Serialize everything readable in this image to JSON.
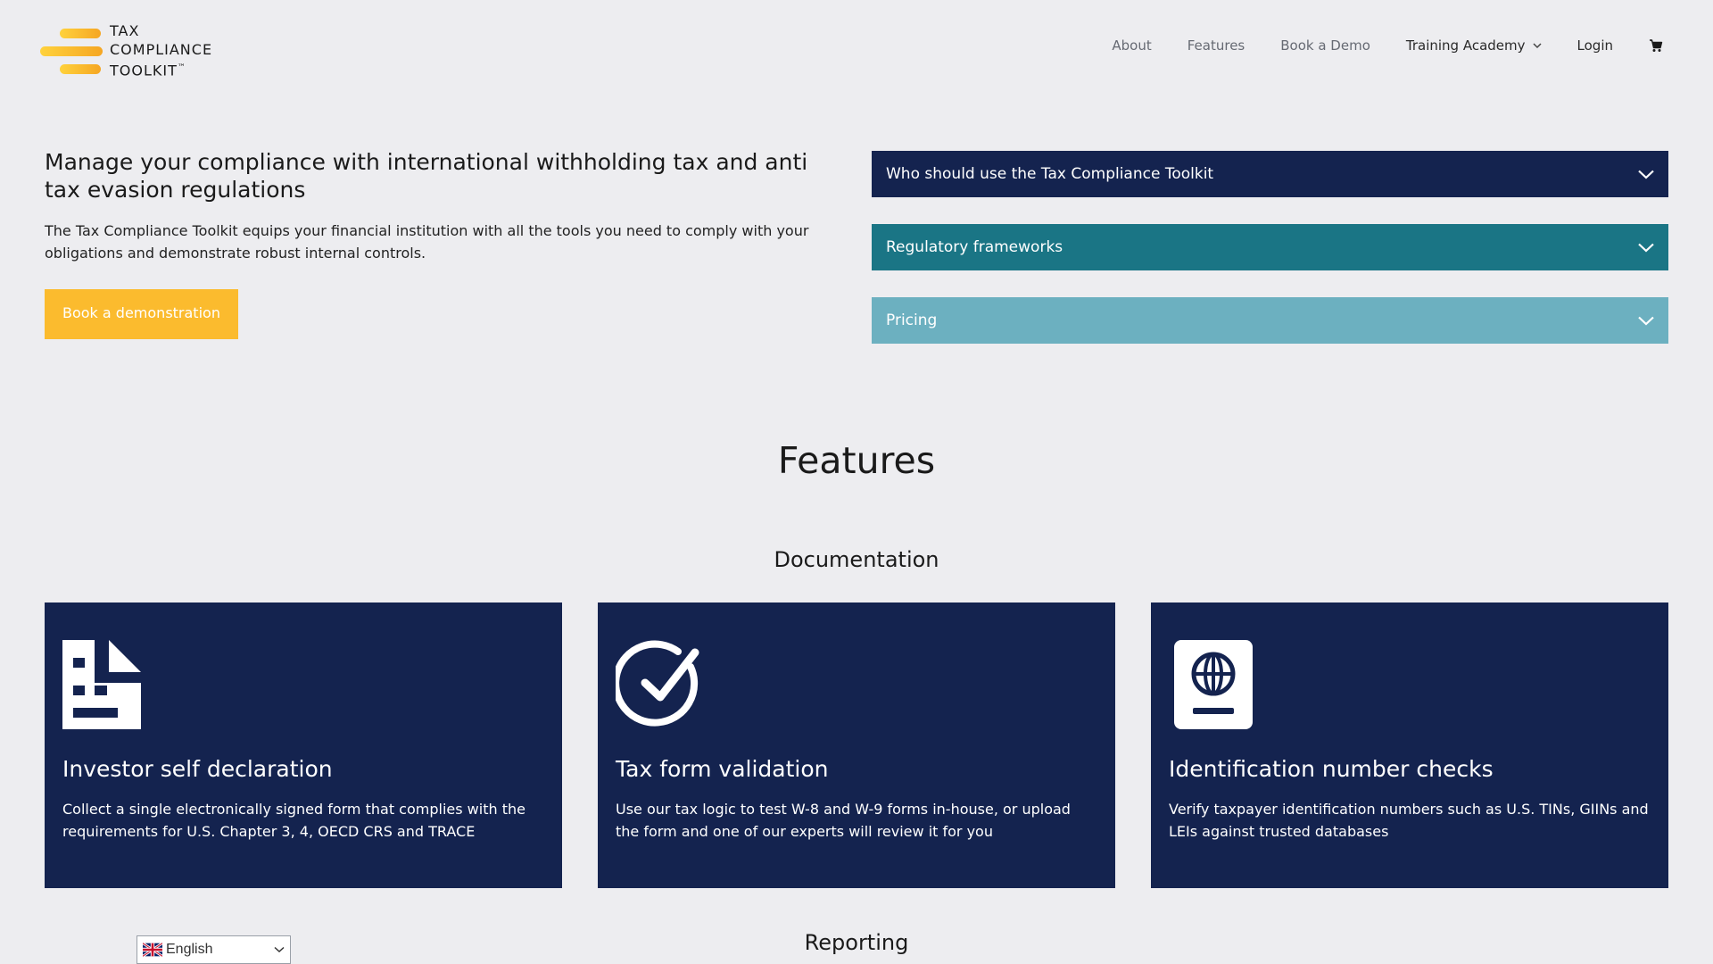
{
  "brand": {
    "line1": "TAX",
    "line2": "COMPLIANCE",
    "line3": "TOOLKIT",
    "tm": "™",
    "accent_gradient": [
      "#ffd23c",
      "#f5a623"
    ]
  },
  "nav": {
    "items": [
      {
        "label": "About"
      },
      {
        "label": "Features"
      },
      {
        "label": "Book a Demo"
      },
      {
        "label": "Training Academy"
      },
      {
        "label": "Login"
      }
    ],
    "cart_icon": "cart-icon"
  },
  "hero": {
    "title": "Manage your compliance with international withholding tax and anti tax evasion regulations",
    "description": "The Tax Compliance Toolkit equips your financial institution with all the tools you need to comply with your obligations and demonstrate robust internal controls.",
    "cta_label": "Book a demonstration",
    "cta_color": "#fbbb2e"
  },
  "accordion": {
    "items": [
      {
        "label": "Who should use the Tax Compliance Toolkit",
        "color": "#14234f"
      },
      {
        "label": "Regulatory frameworks",
        "color": "#1a7585"
      },
      {
        "label": "Pricing",
        "color": "#6cb0c0"
      }
    ]
  },
  "features": {
    "title": "Features",
    "documentation_title": "Documentation",
    "cards": [
      {
        "icon": "document-icon",
        "title": "Investor self declaration",
        "description": "Collect a single electronically signed form that complies with the requirements for U.S. Chapter 3, 4, OECD CRS and TRACE"
      },
      {
        "icon": "check-circle-icon",
        "title": "Tax form validation",
        "description": "Use our tax logic to test W-8 and W-9 forms in-house, or upload the form and one of our experts will review it for you"
      },
      {
        "icon": "passport-icon",
        "title": "Identification number checks",
        "description": "Verify taxpayer identification numbers such as U.S. TINs, GIINs and LEIs against trusted databases"
      }
    ],
    "reporting_title": "Reporting",
    "card_color": "#14234f"
  },
  "language": {
    "selected": "English",
    "flag_icon": "uk-flag-icon"
  }
}
